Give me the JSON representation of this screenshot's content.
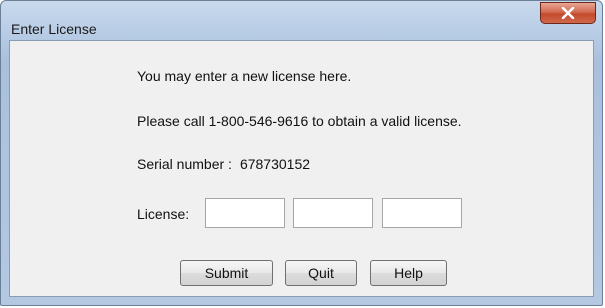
{
  "window": {
    "title": "Enter License",
    "close_glyph": "X"
  },
  "content": {
    "intro": "You may enter a new license here.",
    "call_text": "Please call 1-800-546-9616 to obtain a valid license.",
    "serial_label": "Serial number :",
    "serial_value": "678730152",
    "license_label": "License:",
    "license_fields": [
      "",
      "",
      ""
    ]
  },
  "buttons": {
    "submit": "Submit",
    "quit": "Quit",
    "help": "Help"
  },
  "icons": {
    "close": "close-icon"
  },
  "colors": {
    "title_bar": "#b9cde6",
    "close_button": "#c44a2c",
    "client_background": "#f0f0f0"
  }
}
